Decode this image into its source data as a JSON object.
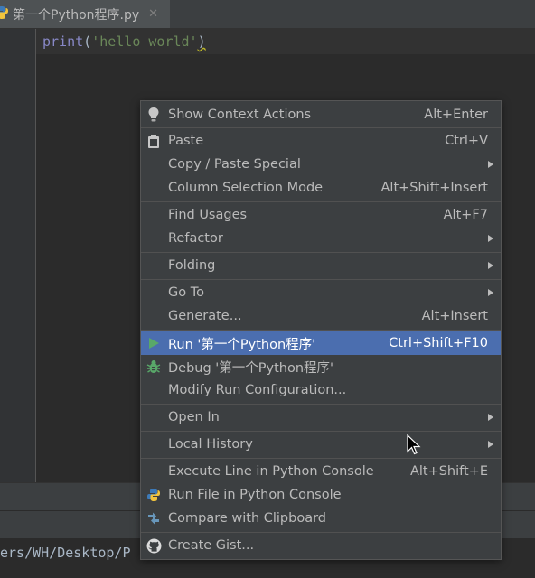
{
  "tab": {
    "title": "第一个Python程序.py",
    "close": "✕"
  },
  "code": {
    "func": "print",
    "open": "(",
    "str": "'hello world'",
    "close": ")"
  },
  "console": {
    "text": "ers/WH/Desktop/P"
  },
  "menu": {
    "show_context_actions": {
      "label": "Show Context Actions",
      "shortcut": "Alt+Enter"
    },
    "paste": {
      "label": "Paste",
      "shortcut": "Ctrl+V"
    },
    "copy_paste_special": {
      "label": "Copy / Paste Special"
    },
    "column_selection": {
      "label": "Column Selection Mode",
      "shortcut": "Alt+Shift+Insert"
    },
    "find_usages": {
      "label": "Find Usages",
      "shortcut": "Alt+F7"
    },
    "refactor": {
      "label": "Refactor"
    },
    "folding": {
      "label": "Folding"
    },
    "go_to": {
      "label": "Go To"
    },
    "generate": {
      "label": "Generate...",
      "shortcut": "Alt+Insert"
    },
    "run": {
      "label": "Run '第一个Python程序'",
      "shortcut": "Ctrl+Shift+F10"
    },
    "debug": {
      "label": "Debug '第一个Python程序'"
    },
    "modify_run": {
      "label": "Modify Run Configuration..."
    },
    "open_in": {
      "label": "Open In"
    },
    "local_history": {
      "label": "Local History"
    },
    "execute_line": {
      "label": "Execute Line in Python Console",
      "shortcut": "Alt+Shift+E"
    },
    "run_file_console": {
      "label": "Run File in Python Console"
    },
    "compare_clipboard": {
      "label": "Compare with Clipboard"
    },
    "create_gist": {
      "label": "Create Gist..."
    }
  },
  "colors": {
    "selection": "#4b6eaf",
    "run_green": "#59a869",
    "debug_green": "#59a869",
    "bg": "#2b2b2b",
    "menu_bg": "#3c3f41"
  }
}
